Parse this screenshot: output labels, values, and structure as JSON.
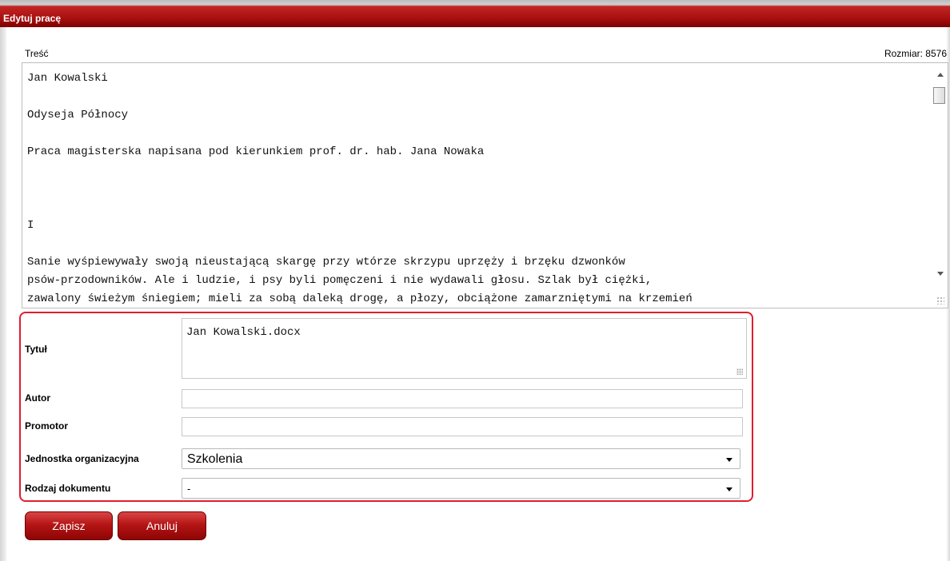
{
  "window": {
    "title": "Edytuj pracę"
  },
  "content": {
    "label": "Treść",
    "size_label": "Rozmiar: 8576",
    "lines": [
      "Jan Kowalski",
      "",
      "Odyseja Północy",
      "",
      "Praca magisterska napisana pod kierunkiem prof. dr. hab. Jana Nowaka",
      "",
      "",
      "",
      "I",
      "",
      "Sanie wyśpiewywały swoją nieustającą skargę przy wtórze skrzypu uprzęży i brzęku dzwonków",
      "psów-przodowników. Ale i ludzie, i psy byli pomęczeni i nie wydawali głosu. Szlak był ciężki,",
      "zawalony świeżym śniegiem; mieli za sobą daleką drogę, a płozy, obciążone zamarzniętymi na krzemień"
    ]
  },
  "form": {
    "title": {
      "label": "Tytuł",
      "value": "Jan Kowalski.docx"
    },
    "author": {
      "label": "Autor",
      "value": ""
    },
    "promoter": {
      "label": "Promotor",
      "value": ""
    },
    "org_unit": {
      "label": "Jednostka organizacyjna",
      "value": "Szkolenia"
    },
    "doc_type": {
      "label": "Rodzaj dokumentu",
      "value": "-"
    }
  },
  "buttons": {
    "save": "Zapisz",
    "cancel": "Anuluj"
  },
  "colors": {
    "accent": "#a60e0e",
    "highlight_border": "#e11d2e"
  }
}
